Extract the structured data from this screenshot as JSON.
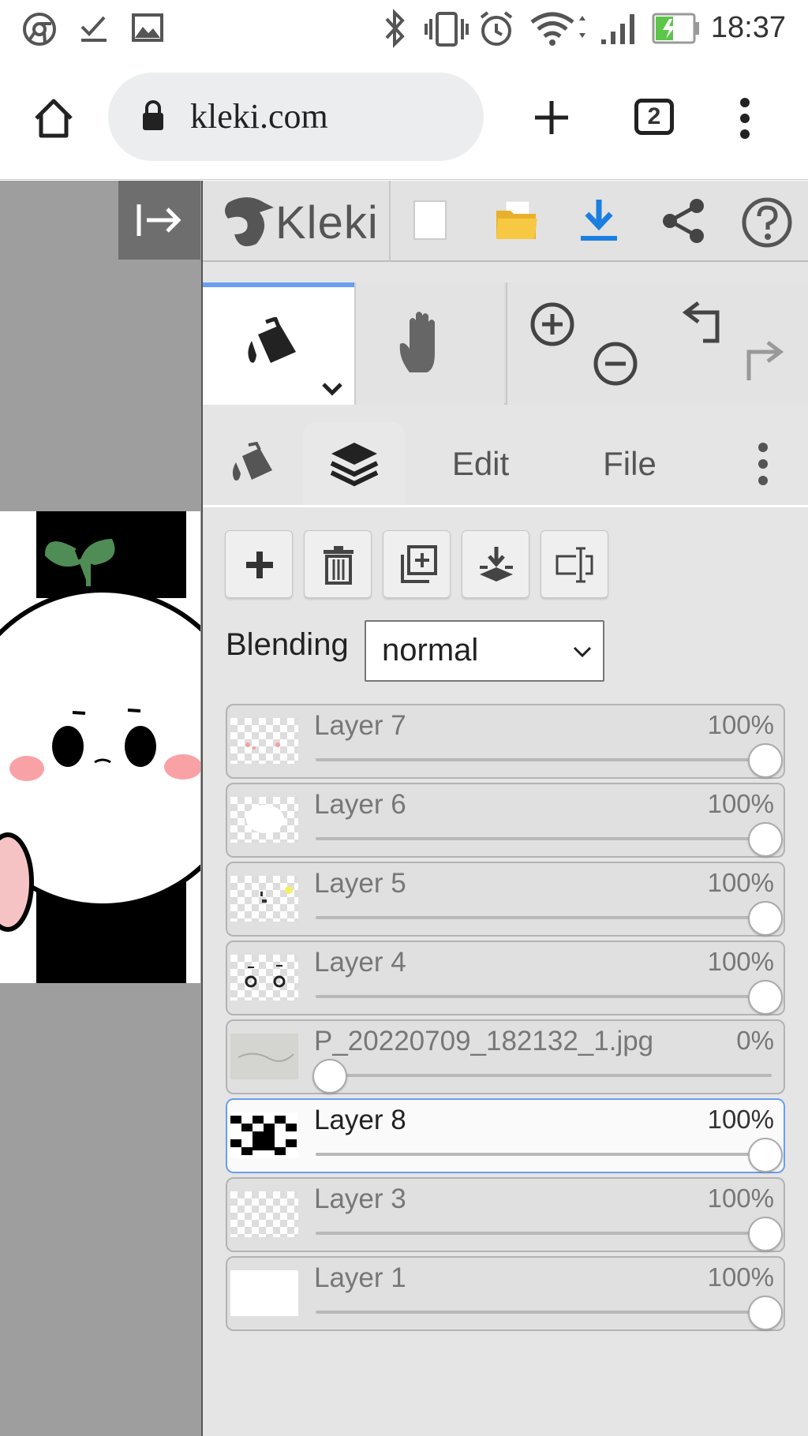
{
  "status_bar": {
    "time": "18:37",
    "left_icons": [
      "chrome-icon",
      "download-done-icon",
      "image-icon"
    ],
    "right_icons": [
      "bluetooth-icon",
      "vibrate-icon",
      "alarm-icon",
      "wifi-icon",
      "signal-icon",
      "battery-charging-icon"
    ]
  },
  "browser": {
    "url": "kleki.com",
    "tab_count": "2",
    "icons": [
      "home-icon",
      "lock-icon",
      "new-tab-icon",
      "tab-switcher-icon",
      "menu-dots-icon"
    ]
  },
  "app": {
    "brand": "Kleki",
    "toolbar_icons": [
      "new-image-icon",
      "open-folder-icon",
      "save-download-icon",
      "share-icon",
      "help-icon"
    ],
    "tools": [
      "fill-bucket-icon",
      "hand-icon",
      "zoom-in-icon",
      "zoom-out-icon",
      "undo-icon",
      "redo-icon"
    ],
    "tabs": {
      "edit": "Edit",
      "file": "File"
    },
    "layer_buttons": [
      "add-layer-icon",
      "delete-layer-icon",
      "duplicate-layer-icon",
      "merge-down-icon",
      "rename-layer-icon"
    ],
    "blending_label": "Blending",
    "blending_value": "normal",
    "layers": [
      {
        "name": "Layer 7",
        "opacity_label": "100%",
        "opacity": 1.0,
        "active": false
      },
      {
        "name": "Layer 6",
        "opacity_label": "100%",
        "opacity": 1.0,
        "active": false
      },
      {
        "name": "Layer 5",
        "opacity_label": "100%",
        "opacity": 1.0,
        "active": false
      },
      {
        "name": "Layer 4",
        "opacity_label": "100%",
        "opacity": 1.0,
        "active": false
      },
      {
        "name": "P_20220709_182132_1.jpg",
        "opacity_label": "0%",
        "opacity": 0.0,
        "active": false
      },
      {
        "name": "Layer 8",
        "opacity_label": "100%",
        "opacity": 1.0,
        "active": true
      },
      {
        "name": "Layer 3",
        "opacity_label": "100%",
        "opacity": 1.0,
        "active": false
      },
      {
        "name": "Layer 1",
        "opacity_label": "100%",
        "opacity": 1.0,
        "active": false
      }
    ]
  }
}
